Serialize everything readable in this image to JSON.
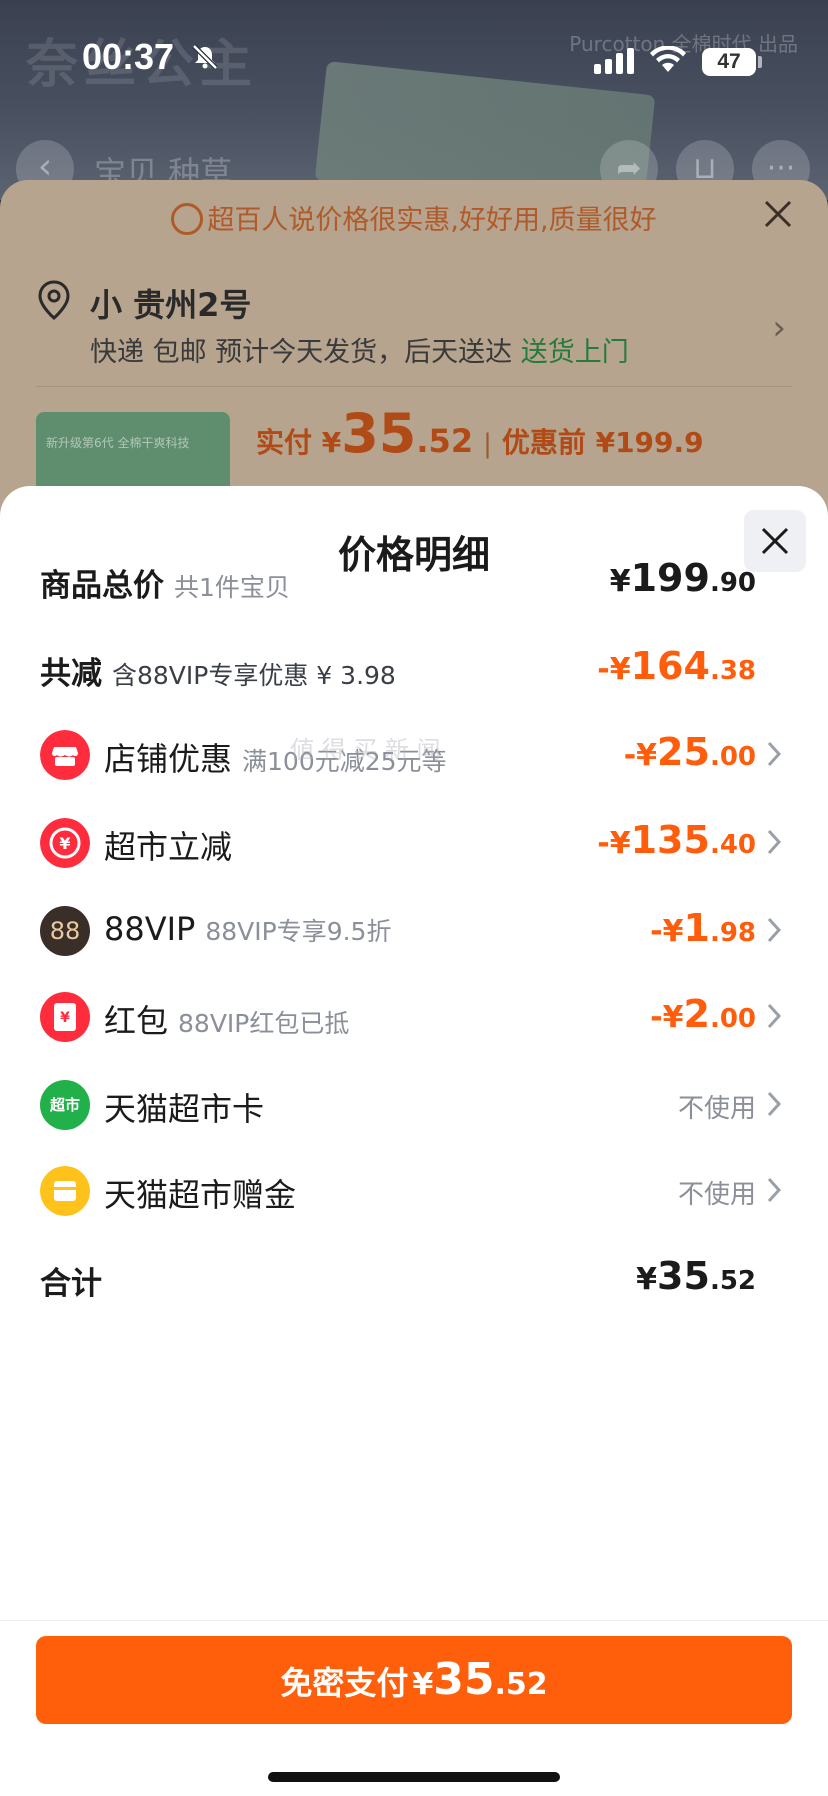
{
  "status_bar": {
    "time": "00:37",
    "battery": "47"
  },
  "background": {
    "brand": "奈丝公主",
    "brand_right": "Purcotton 全棉时代 出品",
    "nav_tabs": "宝贝  种草",
    "notice": "超百人说价格很实惠,好好用,质量很好",
    "address_name": "小 贵州2号",
    "delivery": "快递 包邮 预计今天发货，后天送达",
    "delivery_highlight": "送货上门",
    "product_thumb_text": "新升级第6代  全棉干爽科技",
    "pay_label": "实付 ¥",
    "pay_int": "35",
    "pay_dec": ".52",
    "pay_before": "优惠前 ¥199.9"
  },
  "modal": {
    "title": "价格明细",
    "rows": [
      {
        "label": "商品总价",
        "note": "共1件宝贝",
        "cur": "¥",
        "int": "199",
        "dec": ".90"
      },
      {
        "label": "共减",
        "note": "含88VIP专享优惠 ¥ 3.98",
        "cur": "-¥",
        "int": "164",
        "dec": ".38"
      },
      {
        "label": "店铺优惠",
        "note": "满100元减25元等",
        "cur": "-¥",
        "int": "25",
        "dec": ".00",
        "icon": "store-icon"
      },
      {
        "label": "超市立减",
        "note": "",
        "cur": "-¥",
        "int": "135",
        "dec": ".40",
        "icon": "discount-icon"
      },
      {
        "label": "88VIP",
        "note": "88VIP专享9.5折",
        "cur": "-¥",
        "int": "1",
        "dec": ".98",
        "icon": "vip-icon",
        "icon_text": "88"
      },
      {
        "label": "红包",
        "note": "88VIP红包已抵",
        "cur": "-¥",
        "int": "2",
        "dec": ".00",
        "icon": "red-envelope-icon",
        "icon_text": "¥"
      },
      {
        "label": "天猫超市卡",
        "status": "不使用",
        "icon": "supermarket-card-icon",
        "icon_text": "超市"
      },
      {
        "label": "天猫超市赠金",
        "status": "不使用",
        "icon": "gift-money-icon"
      },
      {
        "label": "合计",
        "cur": "¥",
        "int": "35",
        "dec": ".52"
      }
    ],
    "watermark": "値 得 买 新 闻",
    "pay_button": {
      "label": "免密支付",
      "cur": "¥",
      "int": "35",
      "dec": ".52"
    }
  },
  "colors": {
    "accent": "#ff5f0a",
    "discount": "#ff5d0c",
    "green": "#267a3c"
  }
}
